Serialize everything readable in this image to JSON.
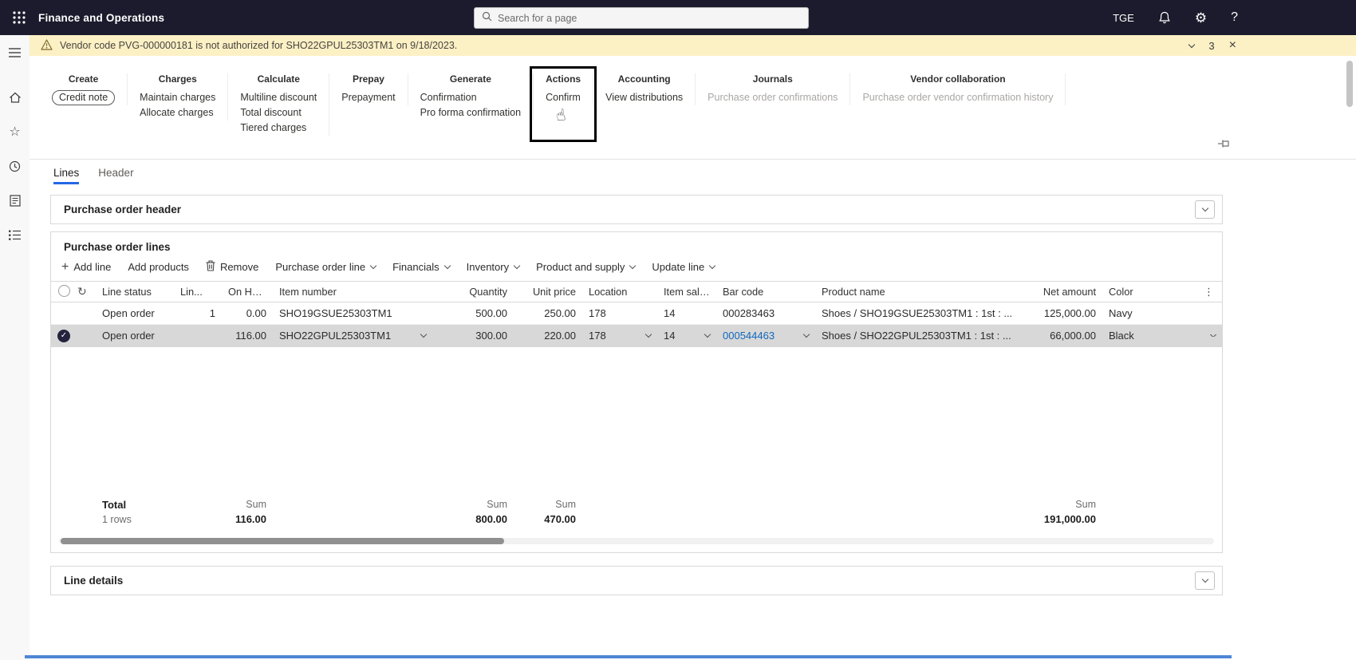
{
  "topbar": {
    "app_title": "Finance and Operations",
    "search_placeholder": "Search for a page",
    "user_initials": "TGE"
  },
  "banner": {
    "message": "Vendor code PVG-000000181 is not authorized for SHO22GPUL25303TM1 on 9/18/2023.",
    "count": "3"
  },
  "ribbon": {
    "groups": [
      {
        "title": "Create",
        "items": [
          "Credit note"
        ]
      },
      {
        "title": "Charges",
        "items": [
          "Maintain charges",
          "Allocate charges"
        ]
      },
      {
        "title": "Calculate",
        "items": [
          "Multiline discount",
          "Total discount",
          "Tiered charges"
        ]
      },
      {
        "title": "Prepay",
        "items": [
          "Prepayment"
        ]
      },
      {
        "title": "Generate",
        "items": [
          "Confirmation",
          "Pro forma confirmation"
        ]
      },
      {
        "title": "Actions",
        "items": [
          "Confirm"
        ]
      },
      {
        "title": "Accounting",
        "items": [
          "View distributions"
        ]
      },
      {
        "title": "Journals",
        "items": [
          "Purchase order confirmations"
        ]
      },
      {
        "title": "Vendor collaboration",
        "items": [
          "Purchase order vendor confirmation history"
        ]
      }
    ]
  },
  "tabs": [
    {
      "label": "Lines"
    },
    {
      "label": "Header"
    }
  ],
  "sections": {
    "po_header": "Purchase order header",
    "po_lines": "Purchase order lines",
    "line_details": "Line details"
  },
  "toolbar": {
    "items": [
      "Add line",
      "Add products",
      "Remove",
      "Purchase order line",
      "Financials",
      "Inventory",
      "Product and supply",
      "Update line"
    ]
  },
  "grid": {
    "columns": [
      "Line status",
      "Lin...",
      "On Hand",
      "Item number",
      "Quantity",
      "Unit price",
      "Location",
      "Item sales ta...",
      "Bar code",
      "Product name",
      "Net amount",
      "Color"
    ],
    "rows": [
      {
        "line_status": "Open order",
        "lin": "1",
        "on_hand": "0.00",
        "item_number": "SHO19GSUE25303TM1",
        "quantity": "500.00",
        "unit_price": "250.00",
        "location": "178",
        "item_sales_tax": "14",
        "bar_code": "000283463",
        "product_name": "Shoes / SHO19GSUE25303TM1 : 1st : ...",
        "net_amount": "125,000.00",
        "color": "Navy"
      },
      {
        "line_status": "Open order",
        "lin": "",
        "on_hand": "116.00",
        "item_number": "SHO22GPUL25303TM1",
        "quantity": "300.00",
        "unit_price": "220.00",
        "location": "178",
        "item_sales_tax": "14",
        "bar_code": "000544463",
        "product_name": "Shoes / SHO22GPUL25303TM1 : 1st : ...",
        "net_amount": "66,000.00",
        "color": "Black"
      }
    ]
  },
  "totals": {
    "label": "Total",
    "rows_count": "1 rows",
    "sum": "Sum",
    "on_hand": "116.00",
    "quantity": "800.00",
    "unit_price": "470.00",
    "net_amount": "191,000.00"
  },
  "icons": {
    "gear": "⚙",
    "help": "?",
    "refresh": "↻",
    "kebab": "⋮",
    "close": "×",
    "plus": "+",
    "check": "✓",
    "hand": "☝",
    "star": "☆"
  },
  "colors": {
    "topbar_bg": "#1b1b2d",
    "banner_bg": "#fcf0c5",
    "accent": "#2468e5",
    "link": "#1168bd",
    "selected_row": "#d8d8d8",
    "highlight_border": "#000000"
  }
}
